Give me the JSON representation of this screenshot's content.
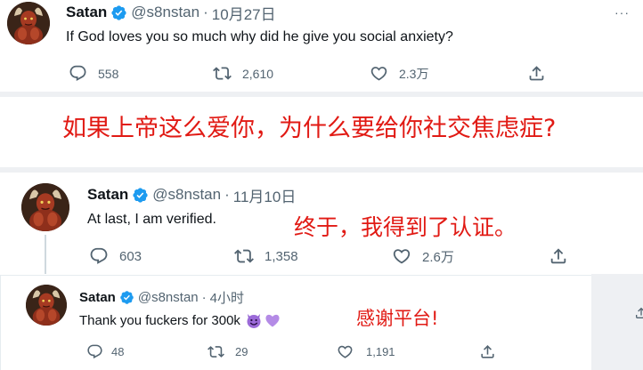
{
  "tweet1": {
    "name": "Satan",
    "handle": "@s8nstan",
    "dot": "·",
    "time": "10月27日",
    "text": "If God loves you so much why did he give you social anxiety?",
    "replies": "558",
    "retweets": "2,610",
    "likes": "2.3万",
    "more": "···"
  },
  "caption1": "如果上帝这么爱你，为什么要给你社交焦虑症?",
  "tweet2": {
    "name": "Satan",
    "handle": "@s8nstan",
    "dot": "·",
    "time": "11月10日",
    "text": "At last, I am verified.",
    "replies": "603",
    "retweets": "1,358",
    "likes": "2.6万"
  },
  "caption2": "终于，我得到了认证。",
  "tweet3": {
    "name": "Satan",
    "handle": "@s8nstan",
    "dot": "·",
    "time": "4小时",
    "text": "Thank you fuckers for 300k",
    "replies": "48",
    "retweets": "29",
    "likes": "1,191"
  },
  "caption3": "感谢平台!",
  "colors": {
    "verified": "#1d9bf0",
    "muted": "#536471",
    "caption": "#e11a14",
    "separator": "#eef0f3"
  }
}
